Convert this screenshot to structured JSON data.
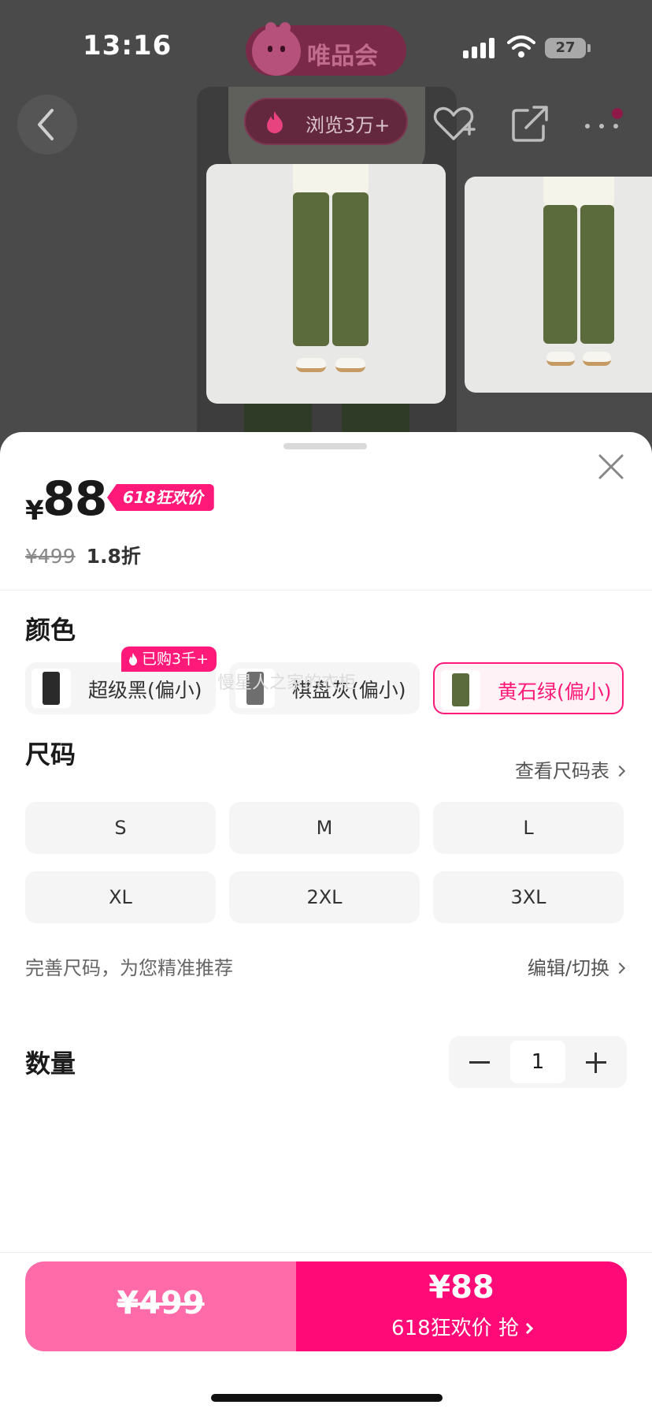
{
  "status_bar": {
    "time": "13:16",
    "app_badge": "唯品会",
    "battery": "27"
  },
  "nav": {
    "views": "浏览3万+"
  },
  "product": {
    "currency": "¥",
    "price": "88",
    "promo_badge": "618狂欢价",
    "original_price": "¥499",
    "discount": "1.8折"
  },
  "color_section": {
    "title": "颜色",
    "sold_tag": "已购3千+",
    "watermark": "慢星人之家的衣柜",
    "options": [
      {
        "label": "超级黑(偏小)",
        "selected": false,
        "swatch": "#2a2a2a"
      },
      {
        "label": "棋盘灰(偏小)",
        "selected": false,
        "swatch": "#6e6e6e"
      },
      {
        "label": "黄石绿(偏小)",
        "selected": true,
        "swatch": "#5c6b3b"
      }
    ]
  },
  "size_section": {
    "title": "尺码",
    "chart_link": "查看尺码表",
    "sizes": [
      "S",
      "M",
      "L",
      "XL",
      "2XL",
      "3XL"
    ],
    "hint": "完善尺码，为您精准推荐",
    "edit_link": "编辑/切换"
  },
  "quantity_section": {
    "title": "数量",
    "value": "1"
  },
  "buy_bar": {
    "original_price": "¥499",
    "price": "¥88",
    "subtitle": "618狂欢价 抢"
  },
  "colors": {
    "accent": "#ff1a7a",
    "accent_light": "#ff6aa8",
    "accent_dark": "#ff0a76"
  }
}
